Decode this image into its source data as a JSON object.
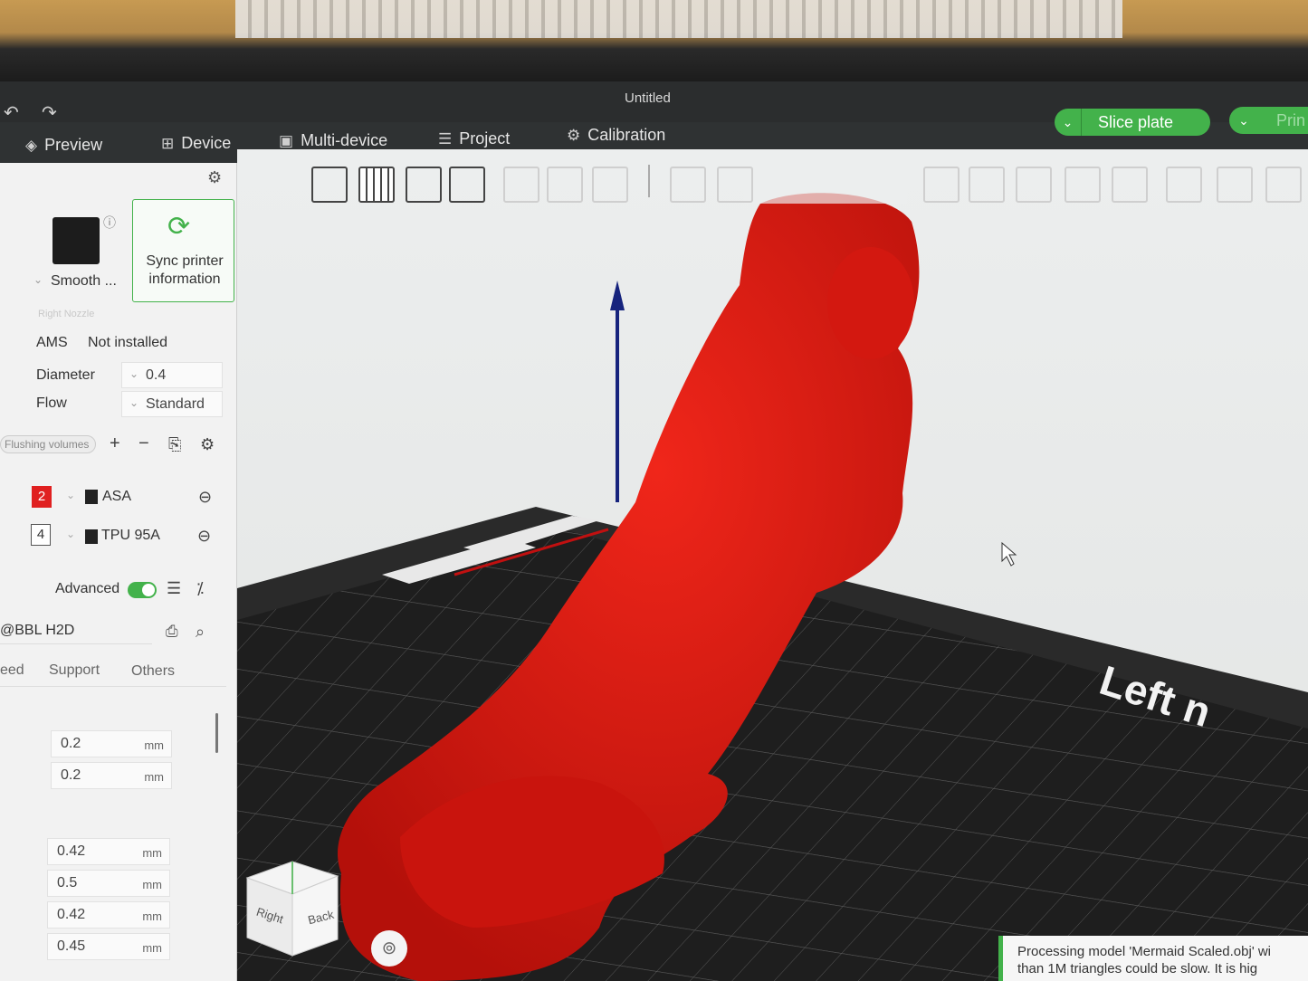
{
  "window": {
    "title": "Untitled"
  },
  "nav": {
    "preview": "Preview",
    "device": "Device",
    "multi_device": "Multi-device",
    "project": "Project",
    "calibration": "Calibration",
    "slice_plate": "Slice plate",
    "print": "Prin"
  },
  "printer": {
    "plate_name": "Smooth ...",
    "sync": "Sync printer information",
    "nozzle_label": "Right Nozzle",
    "ams_label": "AMS",
    "ams_value": "Not installed",
    "diameter_label": "Diameter",
    "diameter_value": "0.4",
    "flow_label": "Flow",
    "flow_value": "Standard"
  },
  "filament": {
    "flushing": "Flushing volumes",
    "items": [
      {
        "slot": "2",
        "name": "ASA",
        "color": "#e02020"
      },
      {
        "slot": "4",
        "name": "TPU 95A",
        "color": "#ffffff"
      }
    ]
  },
  "process": {
    "advanced_label": "Advanced",
    "preset": "@BBL H2D",
    "tabs": [
      "eed",
      "Support",
      "Others"
    ],
    "values": [
      {
        "value": "0.2",
        "unit": "mm"
      },
      {
        "value": "0.2",
        "unit": "mm"
      },
      {
        "value": "0.42",
        "unit": "mm"
      },
      {
        "value": "0.5",
        "unit": "mm"
      },
      {
        "value": "0.42",
        "unit": "mm"
      },
      {
        "value": "0.45",
        "unit": "mm"
      }
    ]
  },
  "viewport": {
    "bed_label": "Left n",
    "cube_right": "Right",
    "cube_back": "Back",
    "model_color": "#e21a12"
  },
  "notification": {
    "line1": "Processing model 'Mermaid Scaled.obj' wi",
    "line2": "than 1M triangles could be slow. It is hig"
  }
}
